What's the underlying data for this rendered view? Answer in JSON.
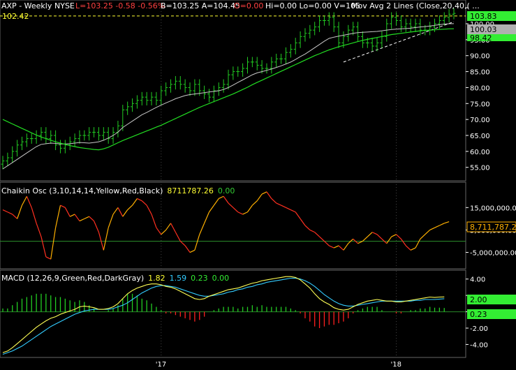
{
  "header": {
    "symbol": "AXP - Weekly",
    "exchange": "NYSE",
    "stats": "L=103.25  -0.58  -0.56%",
    "bar": "B=103.25  A=104.45",
    "open": "O=0.00",
    "rest": "Hi=0.00  Lo=0.00  V=105",
    "ma": "Mov Avg 2 Lines (Close,20,40,( ...",
    "hline": "102.42"
  },
  "colors": {
    "price_bars": "#22cc22",
    "ma20": "#c8c8c8",
    "ma40": "#22dd22",
    "trendline": "#ffffff",
    "resistance": "#ffff33",
    "chaikin_up": "#ffb000",
    "chaikin_down": "#ff3020",
    "macd": "#ffff55",
    "signal": "#33ccff",
    "hist_up": "#22cc22",
    "hist_down": "#ff2020",
    "axis_text": "#ffffff",
    "tag_green": "#33ee33",
    "tag_gray": "#b0b0b0"
  },
  "price_tags": {
    "last": "103.83",
    "ma20": "100.03",
    "ma40": "98.42"
  },
  "chaikin": {
    "label": "Chaikin Osc (3,10,14,14,Yellow,Red,Black)",
    "value": "8711787.26",
    "value2": "0.00",
    "tag": "8,711,787.26"
  },
  "macd": {
    "label": "MACD (12,26,9,Green,Red,DarkGray)",
    "v1": "1.82",
    "v2": "1.59",
    "v3": "0.23",
    "v4": "0.00",
    "tag": "2.00",
    "tag2": "0.23"
  },
  "chart_data": [
    {
      "type": "ohlc",
      "title": "AXP - Weekly NYSE",
      "x_labels": [
        "'17",
        "'18"
      ],
      "y_ticks": [
        55,
        60,
        65,
        70,
        75,
        80,
        85,
        90,
        95,
        100,
        105
      ],
      "y_tick_labels": [
        "55.00",
        "60.00",
        "65.00",
        "70.00",
        "75.00",
        "80.00",
        "85.00",
        "90.00",
        "95.00",
        "100.00",
        "105.00"
      ],
      "ylim": [
        51,
        107
      ],
      "resistance": 102.42,
      "close": [
        57,
        58,
        60,
        62,
        63,
        64,
        64,
        65,
        66,
        64,
        65,
        62,
        61,
        62,
        63,
        64,
        65,
        65,
        66,
        66,
        65,
        66,
        64,
        66,
        68,
        73,
        74,
        75,
        76,
        77,
        76,
        77,
        76,
        79,
        80,
        81,
        82,
        81,
        80,
        79,
        81,
        79,
        78,
        77,
        79,
        80,
        81,
        84,
        85,
        85,
        86,
        88,
        88,
        87,
        86,
        86,
        88,
        89,
        89,
        91,
        92,
        94,
        96,
        97,
        98,
        99,
        101,
        101,
        102,
        99,
        94,
        96,
        98,
        99,
        96,
        94,
        94,
        93,
        94,
        96,
        100,
        102,
        101,
        99,
        100,
        99,
        100,
        98,
        98,
        99,
        100,
        101,
        102,
        103,
        103.25
      ],
      "ma20": [
        54.5,
        55.5,
        56.5,
        57.5,
        58.5,
        59.5,
        60.5,
        61.5,
        62.2,
        62.4,
        62.6,
        62.5,
        62.3,
        62.3,
        62.4,
        62.6,
        62.8,
        62.7,
        62.6,
        62.8,
        63.0,
        63.5,
        64.2,
        65.0,
        66.0,
        67.5,
        68.5,
        69.5,
        70.5,
        71.5,
        72.2,
        73.0,
        73.8,
        74.5,
        75.2,
        75.8,
        76.5,
        77.0,
        77.5,
        77.8,
        78.0,
        78.2,
        78.4,
        78.6,
        78.8,
        79.0,
        79.4,
        80.0,
        80.8,
        81.6,
        82.4,
        83.2,
        84.0,
        84.6,
        85.0,
        85.4,
        85.8,
        86.3,
        86.8,
        87.4,
        88.0,
        88.8,
        89.7,
        90.5,
        91.5,
        92.5,
        93.5,
        94.5,
        95.4,
        95.8,
        96.1,
        96.4,
        96.7,
        97.0,
        97.2,
        97.3,
        97.4,
        97.5,
        97.6,
        97.8,
        98.0,
        98.2,
        98.3,
        98.4,
        98.5,
        98.6,
        98.8,
        99.0,
        99.1,
        99.3,
        99.5,
        99.7,
        99.9,
        100.0,
        100.03
      ],
      "ma40": [
        70.0,
        69.3,
        68.6,
        67.9,
        67.2,
        66.5,
        65.8,
        65.1,
        64.5,
        64.0,
        63.5,
        63.0,
        62.6,
        62.2,
        61.8,
        61.5,
        61.2,
        61.0,
        60.8,
        60.6,
        60.5,
        60.8,
        61.3,
        62.0,
        62.7,
        63.4,
        64.0,
        64.6,
        65.2,
        65.8,
        66.4,
        67.0,
        67.6,
        68.2,
        68.9,
        69.6,
        70.3,
        71.0,
        71.7,
        72.4,
        73.1,
        73.8,
        74.4,
        75.0,
        75.6,
        76.2,
        76.8,
        77.4,
        78.0,
        78.7,
        79.4,
        80.1,
        80.9,
        81.6,
        82.3,
        83.0,
        83.7,
        84.4,
        85.1,
        85.8,
        86.5,
        87.2,
        87.9,
        88.6,
        89.3,
        90.0,
        90.6,
        91.2,
        91.8,
        92.3,
        92.8,
        93.2,
        93.6,
        94.0,
        94.4,
        94.8,
        95.1,
        95.4,
        95.7,
        96.0,
        96.3,
        96.6,
        96.8,
        97.0,
        97.2,
        97.4,
        97.6,
        97.8,
        97.9,
        98.0,
        98.1,
        98.2,
        98.3,
        98.4,
        98.42
      ]
    },
    {
      "type": "line",
      "title": "Chaikin Osc (3,10,14,14,Yellow,Red,Black)",
      "y_ticks": [
        15000000,
        5000000,
        -5000000
      ],
      "y_tick_labels": [
        "15,000,000.00",
        "5,000,000.00",
        "-5,000,000.00"
      ],
      "ylim": [
        -12000000,
        26000000
      ],
      "zero_line": 0,
      "values": [
        14,
        13,
        12,
        10,
        16,
        20,
        15,
        8,
        2,
        -7,
        -8,
        6,
        16,
        15,
        11,
        12,
        9,
        10,
        11,
        9,
        4,
        -4,
        6,
        12,
        15,
        11,
        14,
        16,
        19,
        18,
        16,
        12,
        6,
        3,
        5,
        8,
        4,
        0,
        -2,
        -5,
        -4,
        3,
        8,
        13,
        16,
        19,
        20,
        17,
        15,
        13,
        12,
        13,
        16,
        18,
        21,
        22,
        19,
        17,
        16,
        15,
        14,
        13,
        10,
        7,
        5,
        4,
        2,
        0,
        -2,
        -3,
        -2,
        -4,
        -1,
        1,
        -1,
        0,
        2,
        4,
        3,
        1,
        -1,
        2,
        3,
        1,
        -2,
        -4,
        -3,
        1,
        3,
        5,
        6,
        7,
        8,
        8.7
      ]
    },
    {
      "type": "line+bar",
      "title": "MACD (12,26,9,Green,Red,DarkGray)",
      "y_ticks": [
        4,
        2,
        0,
        -2,
        -4
      ],
      "y_tick_labels": [
        "4.00",
        "2.00",
        "0.00",
        "-2.00",
        "-4.00"
      ],
      "ylim": [
        -5.5,
        5
      ],
      "macd": [
        -5.0,
        -4.8,
        -4.4,
        -3.9,
        -3.4,
        -2.9,
        -2.4,
        -1.9,
        -1.5,
        -1.1,
        -0.8,
        -0.6,
        -0.3,
        -0.1,
        0.1,
        0.3,
        0.6,
        0.7,
        0.6,
        0.5,
        0.3,
        0.3,
        0.4,
        0.6,
        1.0,
        1.6,
        2.2,
        2.6,
        2.9,
        3.1,
        3.3,
        3.4,
        3.4,
        3.3,
        3.1,
        3.0,
        2.8,
        2.5,
        2.2,
        1.9,
        1.6,
        1.5,
        1.6,
        1.9,
        2.1,
        2.3,
        2.5,
        2.7,
        2.8,
        2.9,
        3.1,
        3.3,
        3.5,
        3.6,
        3.8,
        3.9,
        4.0,
        4.1,
        4.2,
        4.3,
        4.3,
        4.2,
        3.9,
        3.4,
        2.9,
        2.2,
        1.6,
        1.2,
        0.9,
        0.5,
        0.3,
        0.2,
        0.3,
        0.6,
        0.9,
        1.1,
        1.3,
        1.4,
        1.5,
        1.4,
        1.3,
        1.3,
        1.2,
        1.2,
        1.3,
        1.4,
        1.5,
        1.6,
        1.7,
        1.8,
        1.75,
        1.8,
        1.82
      ],
      "signal": [
        -5.2,
        -5.0,
        -4.8,
        -4.5,
        -4.2,
        -3.8,
        -3.4,
        -3.0,
        -2.6,
        -2.2,
        -1.8,
        -1.5,
        -1.2,
        -0.9,
        -0.6,
        -0.3,
        -0.1,
        0.1,
        0.2,
        0.3,
        0.3,
        0.3,
        0.3,
        0.4,
        0.6,
        0.8,
        1.1,
        1.5,
        1.9,
        2.3,
        2.6,
        2.9,
        3.1,
        3.2,
        3.2,
        3.1,
        3.0,
        2.8,
        2.6,
        2.4,
        2.2,
        2.0,
        1.9,
        1.9,
        2.0,
        2.1,
        2.2,
        2.4,
        2.5,
        2.7,
        2.8,
        3.0,
        3.1,
        3.3,
        3.4,
        3.6,
        3.7,
        3.8,
        3.9,
        4.0,
        4.1,
        4.1,
        4.0,
        3.8,
        3.5,
        3.1,
        2.6,
        2.1,
        1.7,
        1.3,
        1.0,
        0.8,
        0.7,
        0.7,
        0.8,
        0.9,
        1.0,
        1.1,
        1.2,
        1.3,
        1.3,
        1.3,
        1.3,
        1.3,
        1.3,
        1.3,
        1.4,
        1.4,
        1.5,
        1.5,
        1.5,
        1.55,
        1.59
      ]
    }
  ]
}
